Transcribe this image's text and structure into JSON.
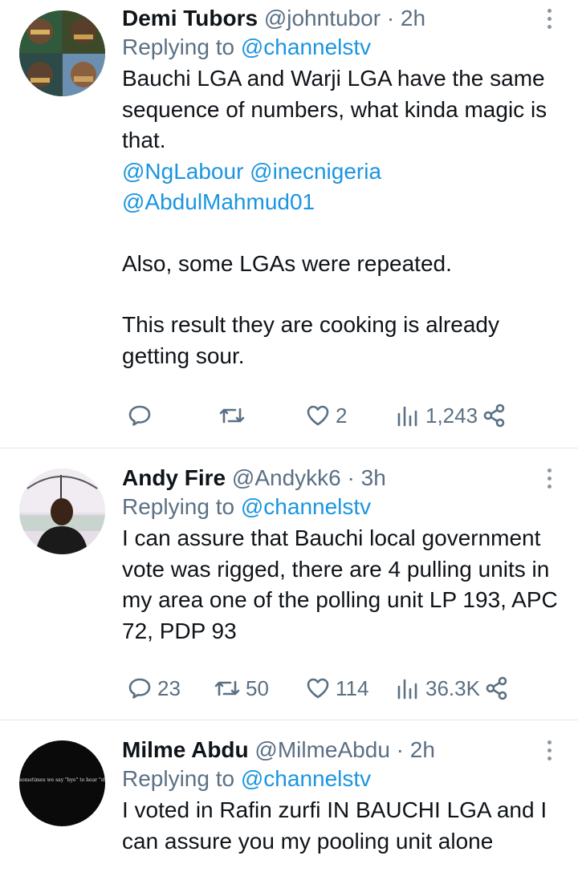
{
  "tweets": [
    {
      "name": "Demi Tubors",
      "handle": "@johntubor",
      "time": "2h",
      "replying_label": "Replying to",
      "replying_to": "@channelstv",
      "text_line1": "Bauchi LGA and Warji LGA have the same sequence of numbers, what kinda magic is that.",
      "mentions_1": "@NgLabour @inecnigeria",
      "mentions_2": "@AbdulMahmud01",
      "text_line2": "Also, some LGAs were repeated.",
      "text_line3": "This result they are cooking is already getting sour.",
      "replies": "",
      "retweets": "",
      "likes": "2",
      "views": "1,243"
    },
    {
      "name": "Andy Fire",
      "handle": "@Andykk6",
      "time": "3h",
      "replying_label": "Replying to",
      "replying_to": "@channelstv",
      "text": "I can assure that Bauchi local government vote was rigged, there are 4 pulling units in my area one of the polling unit LP 193, APC 72, PDP 93",
      "replies": "23",
      "retweets": "50",
      "likes": "114",
      "views": "36.3K"
    },
    {
      "name": "Milme Abdu",
      "handle": "@MilmeAbdu",
      "time": "2h",
      "replying_label": "Replying to",
      "replying_to": "@channelstv",
      "text": "I voted in Rafin zurfi IN BAUCHI LGA and I can assure you my pooling unit alone",
      "avatar_text": "sometimes we say \"bye\" to hear \"stay\""
    }
  ],
  "separator": "·",
  "colors": {
    "link": "#1b95e0",
    "muted": "#5b7083",
    "text": "#0f1419",
    "divider": "#e1e6ea"
  }
}
